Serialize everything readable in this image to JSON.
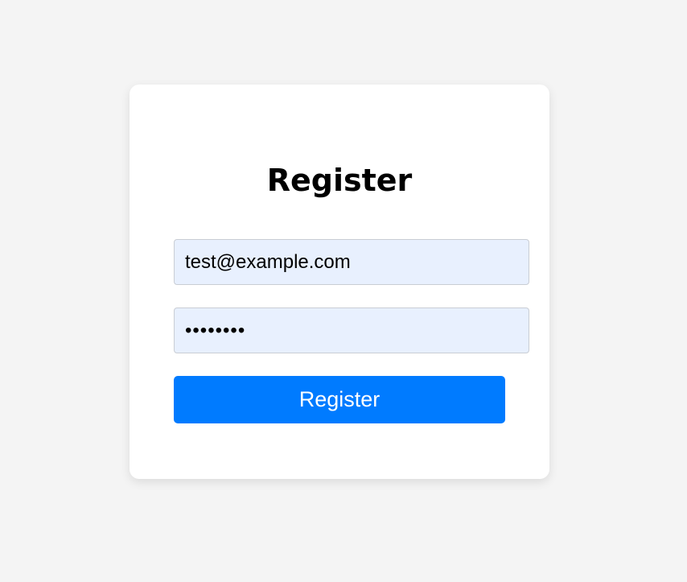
{
  "form": {
    "title": "Register",
    "email_value": "test@example.com",
    "password_value": "testpass",
    "submit_label": "Register"
  },
  "colors": {
    "background": "#f4f4f4",
    "card": "#ffffff",
    "input_fill": "#e8f0fe",
    "button": "#007bff",
    "button_text": "#ffffff"
  }
}
